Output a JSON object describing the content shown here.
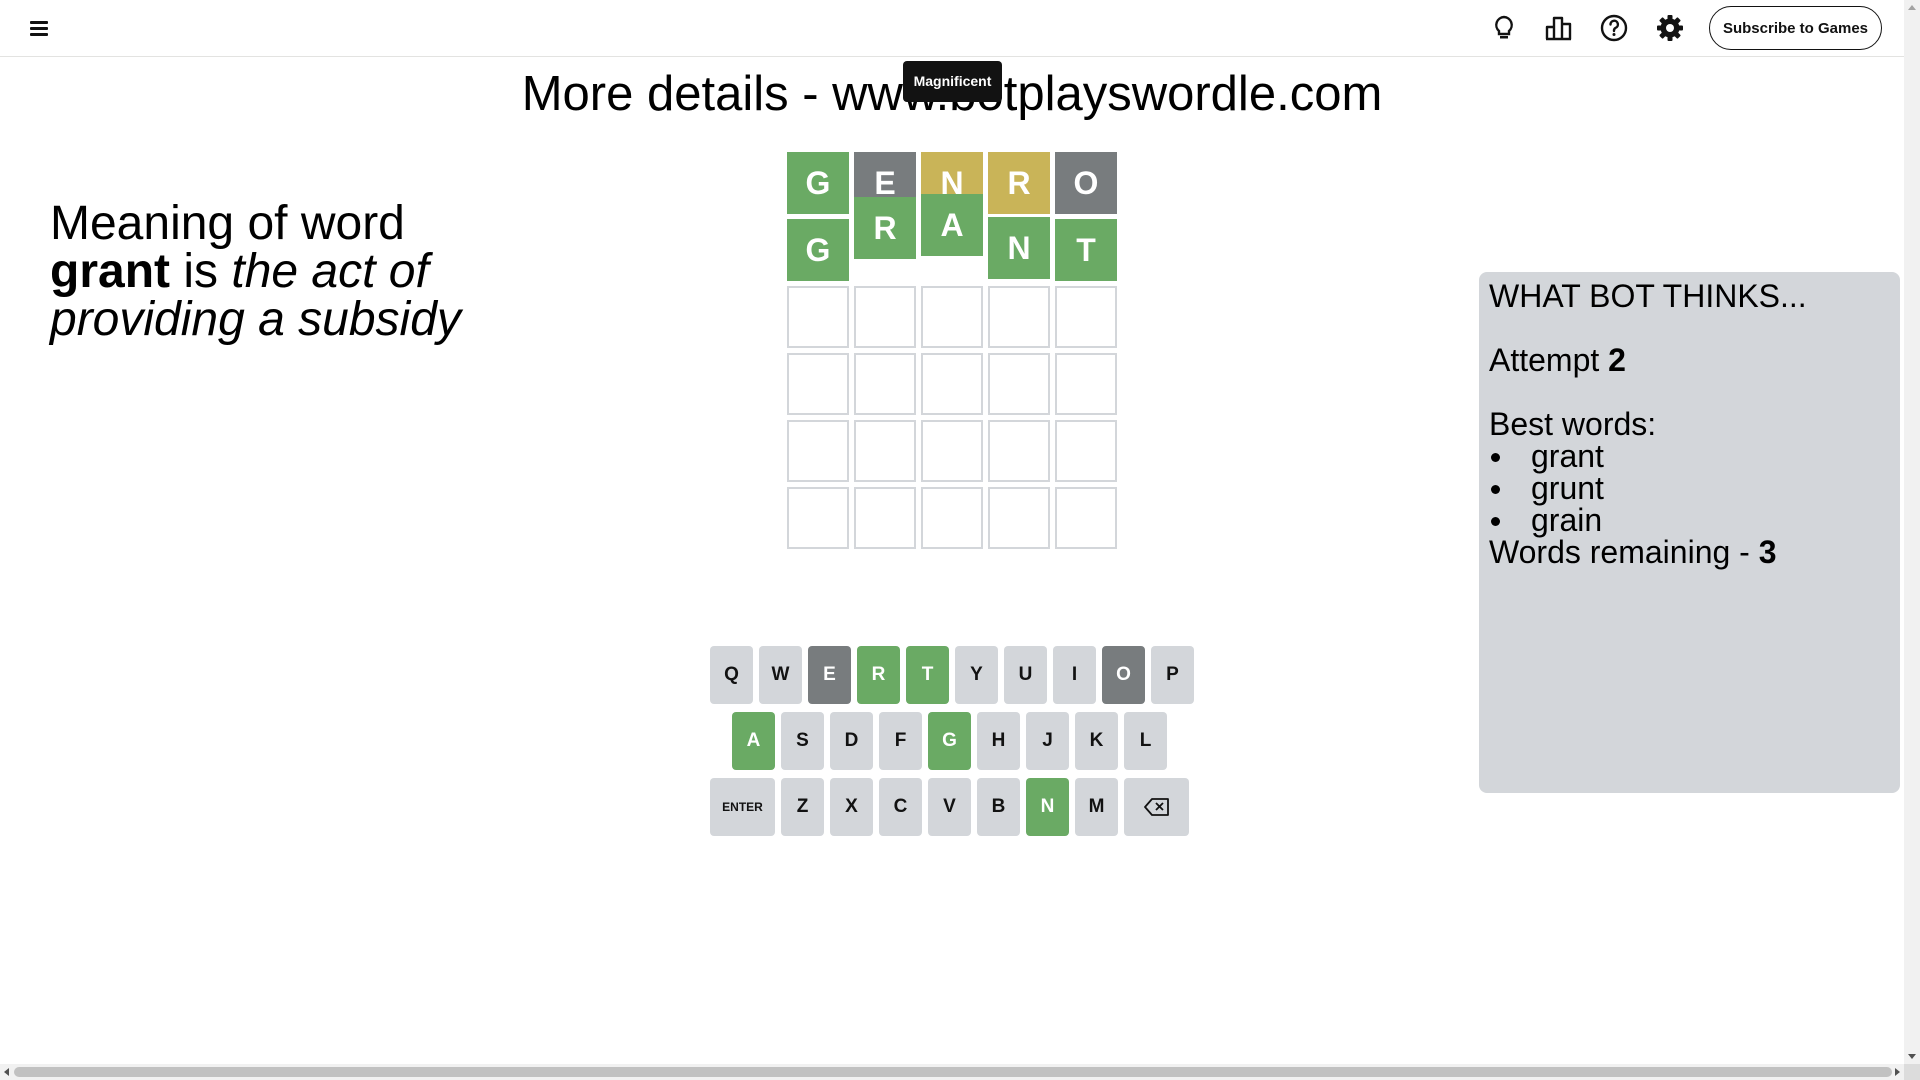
{
  "header": {
    "menu_icon": "hamburger-menu-icon",
    "icons": [
      "lightbulb-icon",
      "stats-bar-chart-icon",
      "help-question-icon",
      "settings-gear-icon"
    ],
    "subscribe_label": "Subscribe to Games"
  },
  "title": "More details - www.botplayswordle.com",
  "toast": "Magnificent",
  "meaning": {
    "prefix": "Meaning of word",
    "word": "grant",
    "connector": "is",
    "definition": "the act of providing a subsidy"
  },
  "board": {
    "rows": [
      [
        {
          "letter": "G",
          "state": "correct"
        },
        {
          "letter": "E",
          "state": "absent"
        },
        {
          "letter": "N",
          "state": "present"
        },
        {
          "letter": "R",
          "state": "present"
        },
        {
          "letter": "O",
          "state": "absent"
        }
      ],
      [
        {
          "letter": "G",
          "state": "correct"
        },
        {
          "letter": "R",
          "state": "correct"
        },
        {
          "letter": "A",
          "state": "correct"
        },
        {
          "letter": "N",
          "state": "correct"
        },
        {
          "letter": "T",
          "state": "correct"
        }
      ],
      [
        {
          "letter": "",
          "state": "empty"
        },
        {
          "letter": "",
          "state": "empty"
        },
        {
          "letter": "",
          "state": "empty"
        },
        {
          "letter": "",
          "state": "empty"
        },
        {
          "letter": "",
          "state": "empty"
        }
      ],
      [
        {
          "letter": "",
          "state": "empty"
        },
        {
          "letter": "",
          "state": "empty"
        },
        {
          "letter": "",
          "state": "empty"
        },
        {
          "letter": "",
          "state": "empty"
        },
        {
          "letter": "",
          "state": "empty"
        }
      ],
      [
        {
          "letter": "",
          "state": "empty"
        },
        {
          "letter": "",
          "state": "empty"
        },
        {
          "letter": "",
          "state": "empty"
        },
        {
          "letter": "",
          "state": "empty"
        },
        {
          "letter": "",
          "state": "empty"
        }
      ],
      [
        {
          "letter": "",
          "state": "empty"
        },
        {
          "letter": "",
          "state": "empty"
        },
        {
          "letter": "",
          "state": "empty"
        },
        {
          "letter": "",
          "state": "empty"
        },
        {
          "letter": "",
          "state": "empty"
        }
      ]
    ]
  },
  "keyboard": {
    "rows": [
      [
        {
          "key": "Q",
          "state": ""
        },
        {
          "key": "W",
          "state": ""
        },
        {
          "key": "E",
          "state": "absent"
        },
        {
          "key": "R",
          "state": "correct"
        },
        {
          "key": "T",
          "state": "correct"
        },
        {
          "key": "Y",
          "state": ""
        },
        {
          "key": "U",
          "state": ""
        },
        {
          "key": "I",
          "state": ""
        },
        {
          "key": "O",
          "state": "absent"
        },
        {
          "key": "P",
          "state": ""
        }
      ],
      [
        {
          "key": "A",
          "state": "correct"
        },
        {
          "key": "S",
          "state": ""
        },
        {
          "key": "D",
          "state": ""
        },
        {
          "key": "F",
          "state": ""
        },
        {
          "key": "G",
          "state": "correct"
        },
        {
          "key": "H",
          "state": ""
        },
        {
          "key": "J",
          "state": ""
        },
        {
          "key": "K",
          "state": ""
        },
        {
          "key": "L",
          "state": ""
        }
      ],
      [
        {
          "key": "ENTER",
          "state": ""
        },
        {
          "key": "Z",
          "state": ""
        },
        {
          "key": "X",
          "state": ""
        },
        {
          "key": "C",
          "state": ""
        },
        {
          "key": "V",
          "state": ""
        },
        {
          "key": "B",
          "state": ""
        },
        {
          "key": "N",
          "state": "correct"
        },
        {
          "key": "M",
          "state": ""
        },
        {
          "key": "backspace-icon",
          "state": ""
        }
      ]
    ]
  },
  "bot": {
    "heading": "WHAT BOT THINKS...",
    "attempt_label": "Attempt",
    "attempt_value": "2",
    "best_label": "Best words:",
    "best_words": [
      "grant",
      "grunt",
      "grain"
    ],
    "remaining_label": "Words remaining -",
    "remaining_value": "3"
  },
  "colors": {
    "correct": "#6aaa64",
    "present": "#c9b458",
    "absent": "#787c7e",
    "key_default": "#d3d6da",
    "panel_bg": "#d3d6da"
  }
}
